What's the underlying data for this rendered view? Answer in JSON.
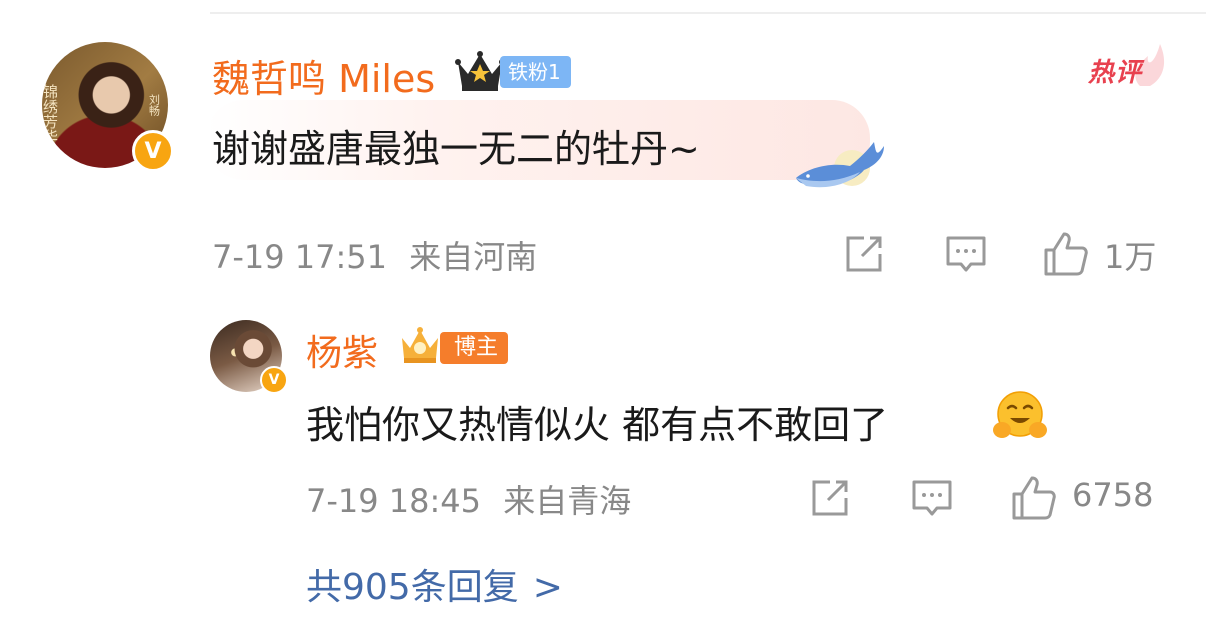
{
  "comment": {
    "username": "魏哲鸣 Miles",
    "fan_badge": "铁粉1",
    "tag": "热评",
    "text": "谢谢盛唐最独一无二的牡丹~",
    "date": "7-19 17:51",
    "location": "来自河南",
    "likes": "1万",
    "avatar_text": [
      "锦绣芳华",
      "刘畅"
    ]
  },
  "reply": {
    "username": "杨紫",
    "badge": "博主",
    "text": "我怕你又热情似火 都有点不敢回了",
    "emoji": "hugging-face",
    "date": "7-19 18:45",
    "location": "来自青海",
    "likes": "6758"
  },
  "more_replies": {
    "label": "共905条回复",
    "chevron": ">"
  },
  "icons": {
    "share": "share-icon",
    "comment": "comment-icon",
    "like": "thumbs-up-icon"
  },
  "colors": {
    "username": "#f26b1d",
    "meta": "#888888",
    "link": "#436aa8",
    "hot_tag": "#e8414f",
    "fan_badge": "#7db6f5",
    "blogger_badge": "#f57d2b",
    "verified": "#f8a511"
  }
}
